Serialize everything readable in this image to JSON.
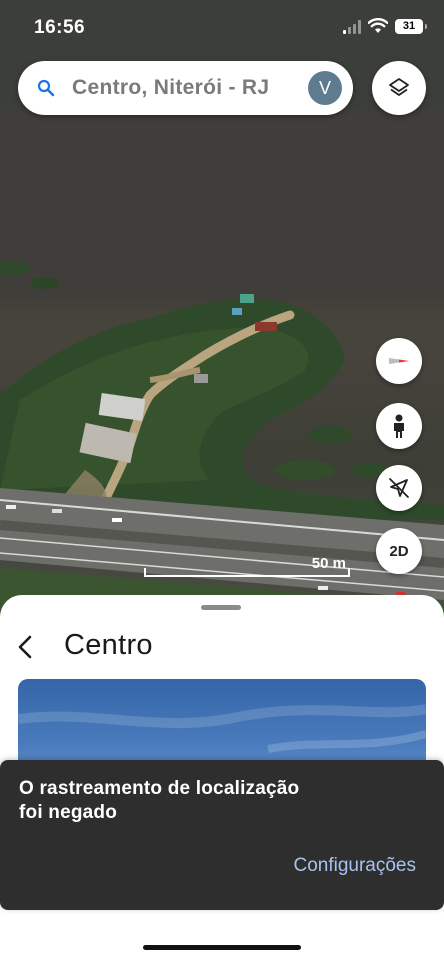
{
  "status_bar": {
    "time": "16:56",
    "battery": "31",
    "signal_icon": "cellular-signal-icon",
    "wifi_icon": "wifi-icon"
  },
  "search": {
    "text": "Centro, Niterói - RJ",
    "icon": "search-icon",
    "avatar_letter": "V"
  },
  "map_controls": {
    "layers_icon": "layers-icon",
    "compass_icon": "compass-icon",
    "street_view_icon": "pegman-icon",
    "location_icon": "location-off-icon",
    "view_mode_label": "2D"
  },
  "scale": {
    "label": "50 m"
  },
  "place_sheet": {
    "back_icon": "chevron-left-icon",
    "title": "Centro"
  },
  "snackbar": {
    "message": "O rastreamento de localização foi negado",
    "action": "Configurações"
  },
  "colors": {
    "snackbar_bg": "#2e2e2e",
    "snackbar_action": "#a8c2f0",
    "accent": "#1a73e8",
    "avatar_bg": "#5f7b8f"
  }
}
